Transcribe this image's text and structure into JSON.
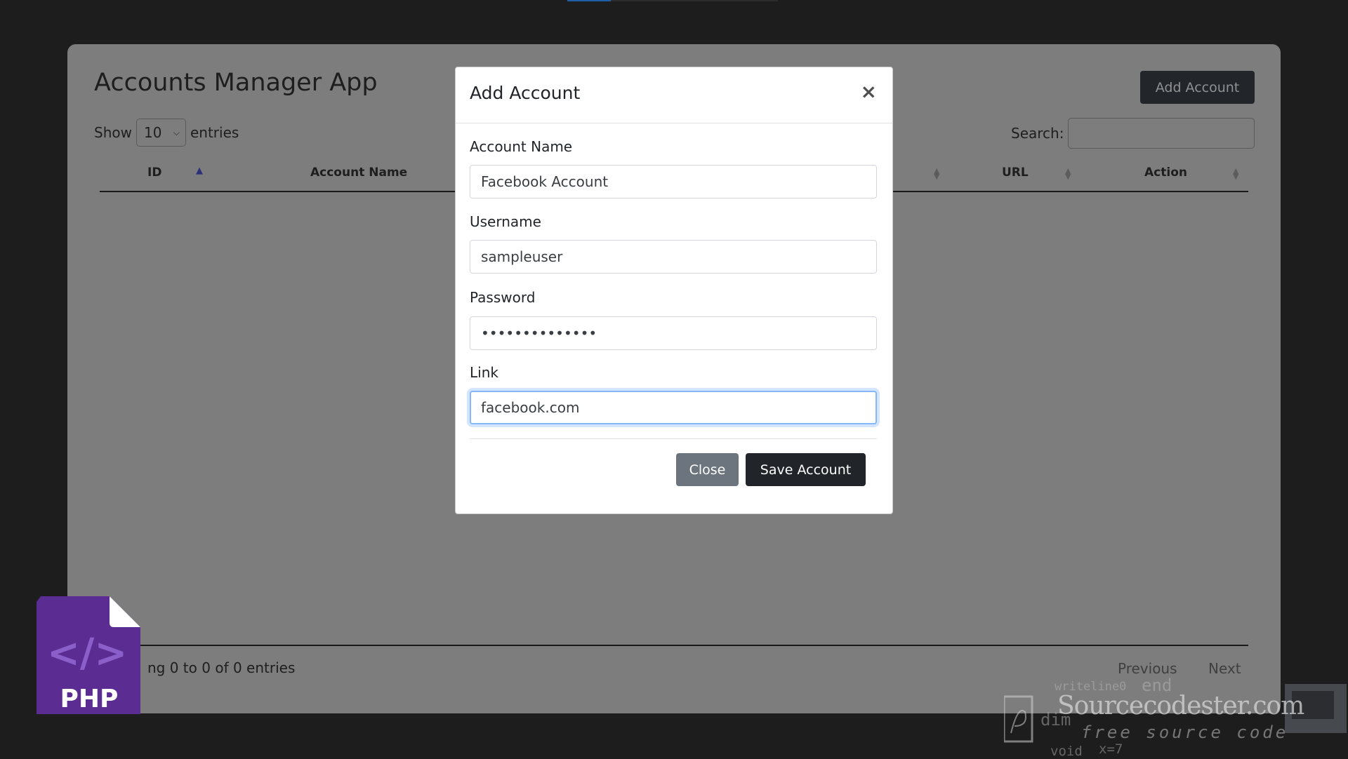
{
  "app": {
    "title": "Accounts Manager App",
    "add_account_label": "Add Account"
  },
  "table_controls": {
    "show_label": "Show",
    "entries_value": "10",
    "entries_label": "entries",
    "search_label": "Search:",
    "search_value": ""
  },
  "table": {
    "columns": [
      "ID",
      "Account Name",
      "URL",
      "Action"
    ]
  },
  "footer": {
    "info": "ng 0 to 0 of 0 entries",
    "previous_label": "Previous",
    "next_label": "Next"
  },
  "modal": {
    "title": "Add Account",
    "close_icon_glyph": "×",
    "fields": {
      "account_name": {
        "label": "Account Name",
        "value": "Facebook Account"
      },
      "username": {
        "label": "Username",
        "value": "sampleuser"
      },
      "password": {
        "label": "Password",
        "value": "••••••••••••••"
      },
      "link": {
        "label": "Link",
        "value": "facebook.com"
      }
    },
    "close_label": "Close",
    "save_label": "Save Account"
  },
  "overlays": {
    "php_badge": "PHP",
    "watermark_main": "Sourcecodester.com",
    "watermark_sub": "free source code",
    "watermark_code": [
      "writeline0",
      "end",
      "dim",
      "void",
      "x=7"
    ]
  },
  "colors": {
    "accent_focus": "#86b7fe",
    "dark_button": "#212529",
    "secondary_button": "#6c757d",
    "php_purple": "#5b2c91"
  }
}
